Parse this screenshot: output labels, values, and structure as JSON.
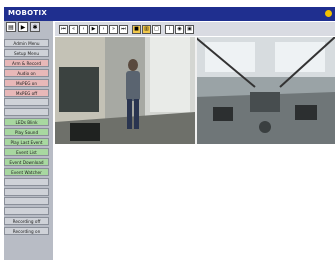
{
  "app": {
    "brand": "MOBOTIX"
  },
  "top_icons": [
    "▤",
    "▶",
    "✱"
  ],
  "sidebar": {
    "items": [
      {
        "label": "Admin Menu",
        "style": "grey"
      },
      {
        "label": "Setup Menu",
        "style": "grey"
      },
      {
        "label": "Arm & Record",
        "style": "pink"
      },
      {
        "label": "Audio on",
        "style": "pink"
      },
      {
        "label": "MxPEG on",
        "style": "pink"
      },
      {
        "label": "MxPEG off",
        "style": "pink"
      },
      {
        "label": "",
        "style": "grey"
      },
      {
        "label": "",
        "style": "grey"
      },
      {
        "label": "LEDs Blink",
        "style": "green"
      },
      {
        "label": "Play Sound",
        "style": "green"
      },
      {
        "label": "Play Last Event",
        "style": "green"
      },
      {
        "label": "Event List",
        "style": "green"
      },
      {
        "label": "Event Download",
        "style": "green"
      },
      {
        "label": "Event Watcher",
        "style": "green"
      },
      {
        "label": "",
        "style": "grey"
      },
      {
        "label": "",
        "style": "grey"
      },
      {
        "label": "",
        "style": "grey"
      },
      {
        "label": "",
        "style": "grey"
      },
      {
        "label": "Recording off",
        "style": "grey"
      },
      {
        "label": "Recording on",
        "style": "grey"
      }
    ]
  },
  "toolbar": {
    "buttons": [
      {
        "icon": "first-icon",
        "glyph": "⏮"
      },
      {
        "icon": "rewind-icon",
        "glyph": "«"
      },
      {
        "icon": "prev-icon",
        "glyph": "‹"
      },
      {
        "icon": "play-icon",
        "glyph": "▶"
      },
      {
        "icon": "next-icon",
        "glyph": "›"
      },
      {
        "icon": "fast-forward-icon",
        "glyph": "»"
      },
      {
        "icon": "last-icon",
        "glyph": "⏭"
      },
      {
        "icon": "live-icon",
        "glyph": "■",
        "highlight": true
      },
      {
        "icon": "dual-view-icon",
        "glyph": "▥",
        "highlight": true
      },
      {
        "icon": "single-view-icon",
        "glyph": "□"
      },
      {
        "icon": "info-icon",
        "glyph": "i"
      },
      {
        "icon": "zoom-icon",
        "glyph": "◉"
      },
      {
        "icon": "snapshot-icon",
        "glyph": "▣"
      }
    ]
  },
  "footer": {
    "text": ""
  }
}
